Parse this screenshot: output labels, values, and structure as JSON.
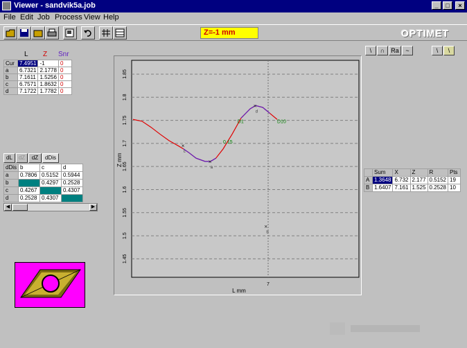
{
  "window": {
    "title": "Viewer - sandvik5a.job",
    "controls": [
      "_",
      "□",
      "×"
    ]
  },
  "menu": [
    "File",
    "Edit",
    "Job",
    "Process",
    "View",
    "Help"
  ],
  "toolbar": {
    "buttons": [
      "open-icon",
      "save-icon",
      "folder-icon",
      "print-icon",
      "export-icon",
      "undo-icon",
      "grid-icon",
      "table-icon"
    ],
    "z_label": "Z=-1 mm",
    "logo": "OPTIMET"
  },
  "view_buttons": [
    "\\",
    "∩",
    "Ra",
    "~",
    "\\",
    "\\"
  ],
  "cursor_table": {
    "headers": [
      "L",
      "Z",
      "Snr"
    ],
    "header_colors": [
      "#000000",
      "#d00000",
      "#6020c0"
    ],
    "rows": [
      {
        "label": "Cur",
        "L": "7.4951",
        "Z": "-1",
        "Snr": "0"
      },
      {
        "label": "a",
        "L": "6.7321",
        "Z": "2.1778",
        "Snr": "0"
      },
      {
        "label": "b",
        "L": "7.1611",
        "Z": "1.5256",
        "Snr": "0"
      },
      {
        "label": "c",
        "L": "6.7571",
        "Z": "1.8632",
        "Snr": "0"
      },
      {
        "label": "d",
        "L": "7.1722",
        "Z": "1.7782",
        "Snr": "0"
      }
    ]
  },
  "tabs": [
    "dL",
    "dZ",
    "dZ",
    "dDis"
  ],
  "distance_table": {
    "headers": [
      "dDis",
      "b",
      "c",
      "d"
    ],
    "rows": [
      {
        "label": "a",
        "cells": [
          "0.7806",
          "0.5152",
          "0.5944"
        ]
      },
      {
        "label": "b",
        "cells": [
          "",
          "0.4297",
          "0.2528"
        ]
      },
      {
        "label": "c",
        "cells": [
          "0.4267",
          "",
          "0.4307"
        ]
      },
      {
        "label": "d",
        "cells": [
          "0.2528",
          "0.4307",
          ""
        ]
      }
    ]
  },
  "chart_data": {
    "type": "line",
    "xlabel": "L mm",
    "ylabel": "Z mm",
    "x_tick_label": "7",
    "yticks": [
      "1.85",
      "1.8",
      "1.75",
      "1.7",
      "1.65",
      "1.6",
      "1.55",
      "1.5",
      "1.45"
    ],
    "ylim": [
      1.41,
      1.88
    ],
    "xlim": [
      0,
      1
    ],
    "grid": "horizontal dashed",
    "series": [
      {
        "color": "#e00000",
        "x": [
          0.0,
          0.05,
          0.1,
          0.15,
          0.2,
          0.25,
          0.28,
          0.31,
          0.35,
          0.4,
          0.43,
          0.46,
          0.5,
          0.55,
          0.6,
          0.65,
          0.68,
          0.72,
          0.76,
          0.8
        ],
        "y": [
          1.752,
          1.748,
          1.735,
          1.72,
          1.706,
          1.695,
          1.688,
          1.68,
          1.668,
          1.661,
          1.661,
          1.668,
          1.688,
          1.72,
          1.755,
          1.775,
          1.782,
          1.778,
          1.765,
          1.752
        ]
      },
      {
        "color": "#6020c0",
        "x": [
          0.28,
          0.31,
          0.35,
          0.4,
          0.43,
          0.46
        ],
        "y": [
          1.688,
          1.68,
          1.668,
          1.661,
          1.661,
          1.668
        ]
      },
      {
        "color": "#6020c0",
        "x": [
          0.6,
          0.65,
          0.68,
          0.72,
          0.76
        ],
        "y": [
          1.755,
          1.775,
          1.782,
          1.778,
          1.765
        ]
      }
    ],
    "markers": [
      {
        "label": "c",
        "x": 0.28,
        "y": 1.695
      },
      {
        "label": "a",
        "x": 0.43,
        "y": 1.661
      },
      {
        "label": "b",
        "x": 0.74,
        "y": 1.52
      },
      {
        "label": "d",
        "x": 0.68,
        "y": 1.782
      }
    ],
    "annotations": [
      {
        "text": "D1",
        "x": 0.58,
        "y": 1.744,
        "color": "#008000"
      },
      {
        "text": "D10",
        "x": 0.8,
        "y": 1.744,
        "color": "#008000"
      },
      {
        "text": "0.15",
        "x": 0.5,
        "y": 1.7,
        "color": "#008000"
      }
    ]
  },
  "results_table": {
    "headers": [
      "",
      "Sum",
      "X",
      "Z",
      "R",
      "Pts"
    ],
    "rows": [
      {
        "label": "A",
        "cells": [
          "1.3648",
          "6.732",
          "2.177",
          "0.5152",
          "19"
        ]
      },
      {
        "label": "B",
        "cells": [
          "1.6407",
          "7.161",
          "1.525",
          "0.2528",
          "10"
        ]
      }
    ]
  }
}
